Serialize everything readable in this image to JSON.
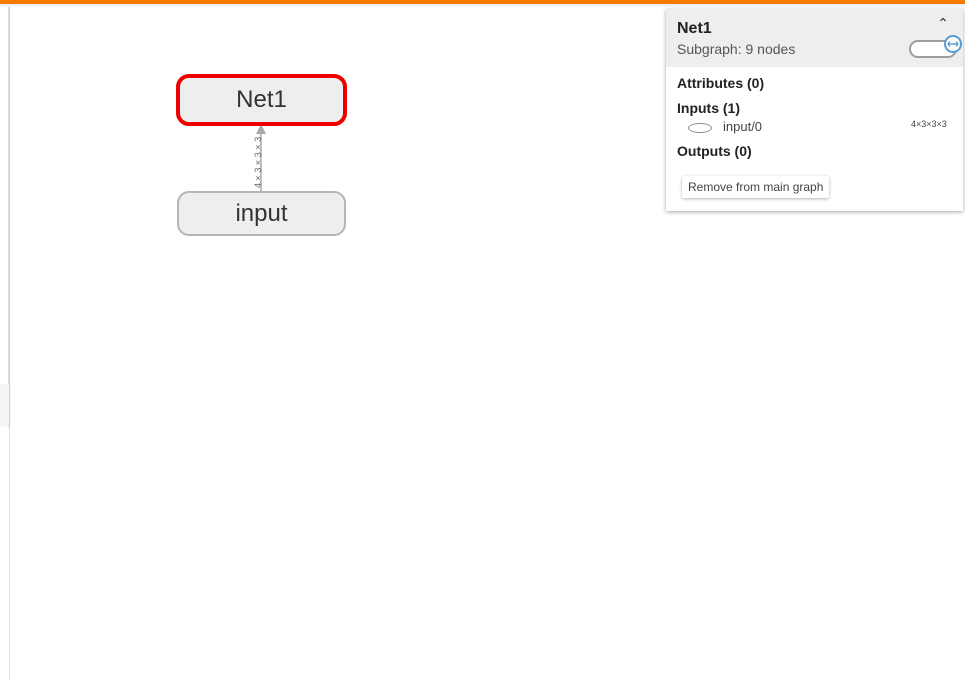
{
  "graph": {
    "nodes": {
      "net1_label": "Net1",
      "input_label": "input"
    },
    "edge": {
      "shape_label": "4×3×3×3"
    }
  },
  "info_card": {
    "title": "Net1",
    "subtitle": "Subgraph: 9 nodes",
    "collapse_icon": "chevron-up-icon",
    "sections": {
      "attributes": "Attributes (0)",
      "inputs": "Inputs (1)",
      "outputs": "Outputs (0)"
    },
    "inputs": [
      {
        "name": "input/0",
        "shape": "4×3×3×3"
      }
    ],
    "remove_button": "Remove from main graph",
    "toggle_on": true
  },
  "colors": {
    "top_bar": "#f57c00",
    "selected_border": "#ee0000",
    "node_fill": "#eeeeee"
  }
}
